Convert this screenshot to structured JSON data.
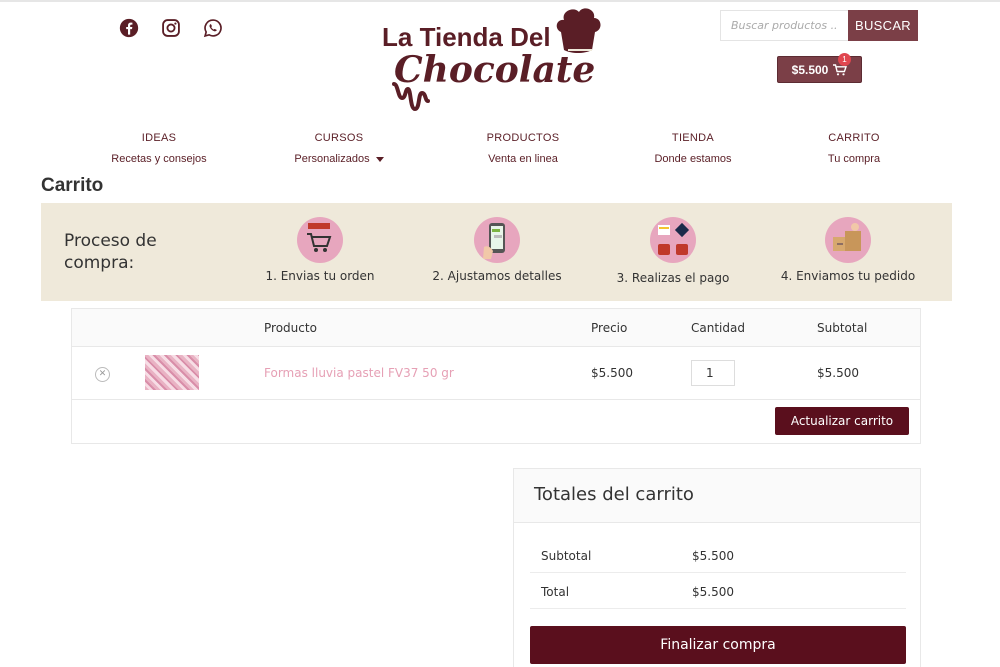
{
  "header": {
    "logo_text_1": "La Tienda Del",
    "logo_text_2": "Chocolate",
    "search_placeholder": "Buscar productos ...",
    "search_button": "BUSCAR",
    "cart_amount": "$5.500",
    "cart_count": "1",
    "social": [
      "facebook-icon",
      "instagram-icon",
      "whatsapp-icon"
    ],
    "colors": {
      "brand": "#5a0f1d",
      "accent": "#7b3f47",
      "banner": "#efe9da",
      "link": "#e6a0b5"
    }
  },
  "nav": [
    {
      "title": "IDEAS",
      "sub": "Recetas y consejos"
    },
    {
      "title": "CURSOS",
      "sub": "Personalizados"
    },
    {
      "title": "PRODUCTOS",
      "sub": "Venta en linea"
    },
    {
      "title": "TIENDA",
      "sub": "Donde estamos"
    },
    {
      "title": "CARRITO",
      "sub": "Tu compra"
    }
  ],
  "page": {
    "title": "Carrito"
  },
  "process": {
    "label": "Proceso de compra:",
    "steps": [
      {
        "caption": "1. Envias tu orden",
        "icon": "cart-icon"
      },
      {
        "caption": "2. Ajustamos detalles",
        "icon": "phone-chat-icon"
      },
      {
        "caption": "3. Realizas el pago",
        "icon": "payment-icon"
      },
      {
        "caption": "4. Enviamos tu pedido",
        "icon": "delivery-icon"
      }
    ]
  },
  "cart": {
    "headers": {
      "product": "Producto",
      "price": "Precio",
      "quantity": "Cantidad",
      "subtotal": "Subtotal"
    },
    "items": [
      {
        "name": "Formas lluvia pastel FV37 50 gr",
        "price": "$5.500",
        "quantity": "1",
        "subtotal": "$5.500"
      }
    ],
    "update_button": "Actualizar carrito"
  },
  "totals": {
    "title": "Totales del carrito",
    "subtotal_label": "Subtotal",
    "subtotal_value": "$5.500",
    "total_label": "Total",
    "total_value": "$5.500",
    "checkout_button": "Finalizar compra"
  }
}
